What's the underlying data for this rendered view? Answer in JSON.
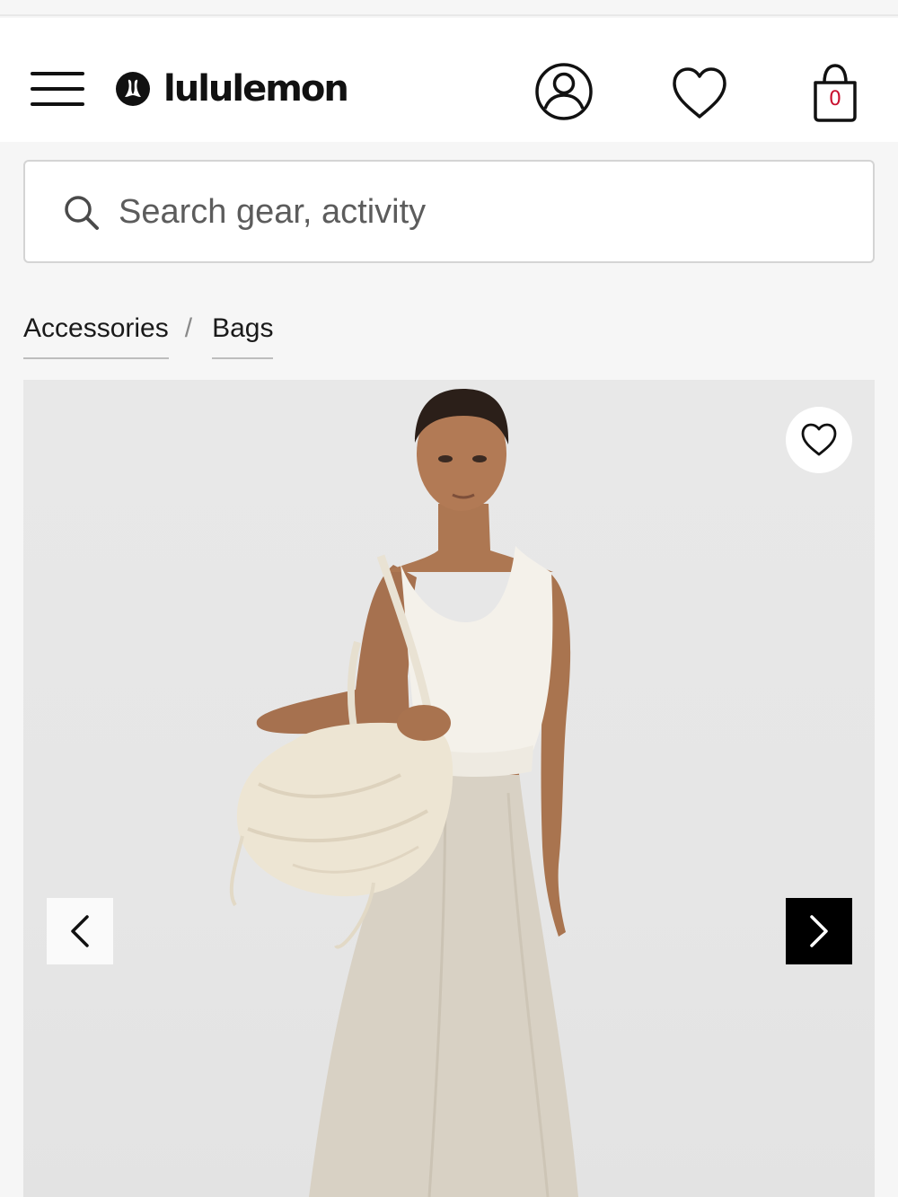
{
  "header": {
    "brand_name": "lululemon",
    "icons": {
      "menu": "hamburger-menu-icon",
      "logo": "lululemon-logo-mark",
      "account": "account-icon",
      "wishlist": "heart-icon",
      "bag": "shopping-bag-icon"
    },
    "bag_count": "0"
  },
  "search": {
    "icon": "search-icon",
    "placeholder": "Search gear, activity",
    "value": ""
  },
  "breadcrumb": {
    "items": [
      {
        "label": "Accessories"
      },
      {
        "label": "Bags"
      }
    ],
    "separator": "/"
  },
  "gallery": {
    "icons": {
      "favorite": "heart-icon",
      "previous": "chevron-left-icon",
      "next": "chevron-right-icon"
    }
  },
  "colors": {
    "brand_red": "#c8102e",
    "header_bg": "#ffffff",
    "page_bg": "#f6f6f6",
    "next_button_bg": "#000000"
  }
}
